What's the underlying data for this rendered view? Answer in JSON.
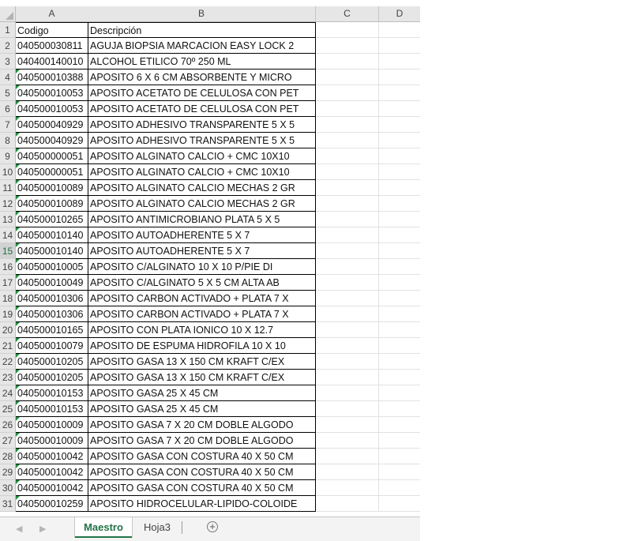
{
  "columns": [
    "A",
    "B",
    "C",
    "D"
  ],
  "rows": [
    {
      "n": "1",
      "a": "Codigo",
      "b": "Descripción",
      "flag": false
    },
    {
      "n": "2",
      "a": "040500030811",
      "b": "AGUJA BIOPSIA MARCACION EASY LOCK 2",
      "flag": false
    },
    {
      "n": "3",
      "a": "040400140010",
      "b": "ALCOHOL ETILICO 70º 250 ML",
      "flag": false
    },
    {
      "n": "4",
      "a": "040500010388",
      "b": "APOSITO 6 X 6 CM ABSORBENTE Y MICRO",
      "flag": true
    },
    {
      "n": "5",
      "a": "040500010053",
      "b": "APOSITO ACETATO DE CELULOSA CON PET",
      "flag": true
    },
    {
      "n": "6",
      "a": "040500010053",
      "b": "APOSITO ACETATO DE CELULOSA CON PET",
      "flag": true
    },
    {
      "n": "7",
      "a": "040500040929",
      "b": "APOSITO ADHESIVO TRANSPARENTE 5 X 5",
      "flag": true
    },
    {
      "n": "8",
      "a": "040500040929",
      "b": "APOSITO ADHESIVO TRANSPARENTE 5 X 5",
      "flag": true
    },
    {
      "n": "9",
      "a": "040500000051",
      "b": "APOSITO ALGINATO CALCIO + CMC 10X10",
      "flag": true
    },
    {
      "n": "10",
      "a": "040500000051",
      "b": "APOSITO ALGINATO CALCIO + CMC 10X10",
      "flag": true
    },
    {
      "n": "11",
      "a": "040500010089",
      "b": "APOSITO ALGINATO CALCIO MECHAS 2 GR",
      "flag": true
    },
    {
      "n": "12",
      "a": "040500010089",
      "b": "APOSITO ALGINATO CALCIO MECHAS 2 GR",
      "flag": true
    },
    {
      "n": "13",
      "a": "040500010265",
      "b": "APOSITO ANTIMICROBIANO PLATA 5 X 5",
      "flag": true
    },
    {
      "n": "14",
      "a": "040500010140",
      "b": "APOSITO AUTOADHERENTE 5 X 7",
      "flag": true
    },
    {
      "n": "15",
      "a": "040500010140",
      "b": "APOSITO AUTOADHERENTE 5 X 7",
      "flag": true
    },
    {
      "n": "16",
      "a": "040500010005",
      "b": "APOSITO C/ALGINATO 10 X 10 P/PIE DI",
      "flag": true
    },
    {
      "n": "17",
      "a": "040500010049",
      "b": "APOSITO C/ALGINATO 5 X 5 CM ALTA AB",
      "flag": true
    },
    {
      "n": "18",
      "a": "040500010306",
      "b": "APOSITO CARBON ACTIVADO + PLATA 7 X",
      "flag": true
    },
    {
      "n": "19",
      "a": "040500010306",
      "b": "APOSITO CARBON ACTIVADO + PLATA 7 X",
      "flag": true
    },
    {
      "n": "20",
      "a": "040500010165",
      "b": "APOSITO CON PLATA IONICO 10 X 12.7",
      "flag": true
    },
    {
      "n": "21",
      "a": "040500010079",
      "b": "APOSITO DE ESPUMA HIDROFILA 10 X 10",
      "flag": true
    },
    {
      "n": "22",
      "a": "040500010205",
      "b": "APOSITO GASA 13 X 150 CM KRAFT C/EX",
      "flag": true
    },
    {
      "n": "23",
      "a": "040500010205",
      "b": "APOSITO GASA 13 X 150 CM KRAFT C/EX",
      "flag": true
    },
    {
      "n": "24",
      "a": "040500010153",
      "b": "APOSITO GASA 25 X 45 CM",
      "flag": true
    },
    {
      "n": "25",
      "a": "040500010153",
      "b": "APOSITO GASA 25 X 45 CM",
      "flag": true
    },
    {
      "n": "26",
      "a": "040500010009",
      "b": "APOSITO GASA 7 X 20 CM DOBLE ALGODO",
      "flag": true
    },
    {
      "n": "27",
      "a": "040500010009",
      "b": "APOSITO GASA 7 X 20 CM DOBLE ALGODO",
      "flag": true
    },
    {
      "n": "28",
      "a": "040500010042",
      "b": "APOSITO GASA CON COSTURA 40 X 50 CM",
      "flag": true
    },
    {
      "n": "29",
      "a": "040500010042",
      "b": "APOSITO GASA CON COSTURA 40 X 50 CM",
      "flag": true
    },
    {
      "n": "30",
      "a": "040500010042",
      "b": "APOSITO GASA CON COSTURA 40 X 50 CM",
      "flag": true
    },
    {
      "n": "31",
      "a": "040500010259",
      "b": "APOSITO HIDROCELULAR-LIPIDO-COLOIDE",
      "flag": true
    }
  ],
  "selected_row": "15",
  "tabs": {
    "nav_prev": "◀",
    "nav_next": "▶",
    "active": "Maestro",
    "inactive": "Hoja3",
    "add": "+"
  },
  "colors": {
    "accent": "#217346",
    "flag": "#1e8c3a",
    "header_bg": "#e6e6e6"
  }
}
